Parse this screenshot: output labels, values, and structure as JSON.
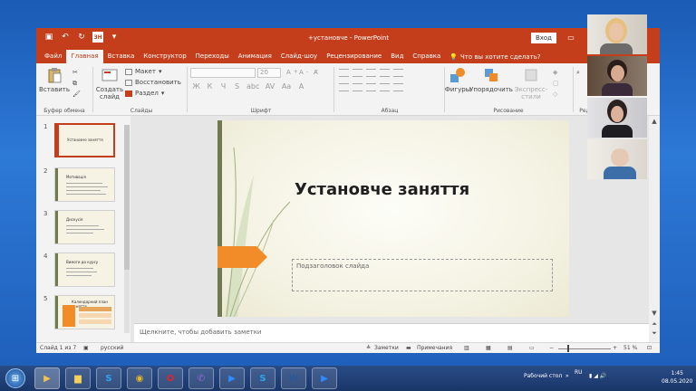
{
  "window": {
    "title": "+установче - PowerPoint",
    "login_label": "Вход",
    "qat_start_label": "ЗН"
  },
  "tabs": [
    "Файл",
    "Главная",
    "Вставка",
    "Конструктор",
    "Переходы",
    "Анимация",
    "Слайд-шоу",
    "Рецензирование",
    "Вид",
    "Справка"
  ],
  "tell_me": "Что вы хотите сделать?",
  "ribbon": {
    "paste_label": "Вставить",
    "clipboard_group": "Буфер обмена",
    "new_slide_label": "Создать слайд",
    "layout_label": "Макет",
    "reset_label": "Восстановить",
    "section_label": "Раздел",
    "slides_group": "Слайды",
    "font_size": "20",
    "font_group": "Шрифт",
    "font_format_buttons": [
      "Ж",
      "К",
      "Ч",
      "S",
      "abc",
      "AV",
      "Aa"
    ],
    "paragraph_group": "Абзац",
    "shapes_label": "Фигуры",
    "arrange_label": "Упорядочить",
    "quick_styles_label": "Экспресс-стили",
    "drawing_group": "Рисование",
    "editing_group": "Ред"
  },
  "slides": [
    {
      "num": "1",
      "title": "Установче заняття"
    },
    {
      "num": "2",
      "title": "Мотивація"
    },
    {
      "num": "3",
      "title": "Дискусія"
    },
    {
      "num": "4",
      "title": "Вимоги до курсу"
    },
    {
      "num": "5",
      "title": "Календарний план заняття"
    }
  ],
  "current_slide": {
    "title": "Установче заняття",
    "subtitle_placeholder": "Подзаголовок слайда"
  },
  "notes_placeholder": "Щелкните, чтобы добавить заметки",
  "status": {
    "slide_info": "Слайд 1 из 7",
    "language": "русский",
    "notes_label": "Заметки",
    "comments_label": "Примечания",
    "zoom": "51 %"
  },
  "taskbar": {
    "desktop_label": "Рабочий стол",
    "lang": "RU",
    "time": "1:45",
    "date": "08.05.2020"
  },
  "colors": {
    "accent": "#c43e1c",
    "slide_bar": "#6f7a4e",
    "slide_arrow": "#f28c28"
  }
}
